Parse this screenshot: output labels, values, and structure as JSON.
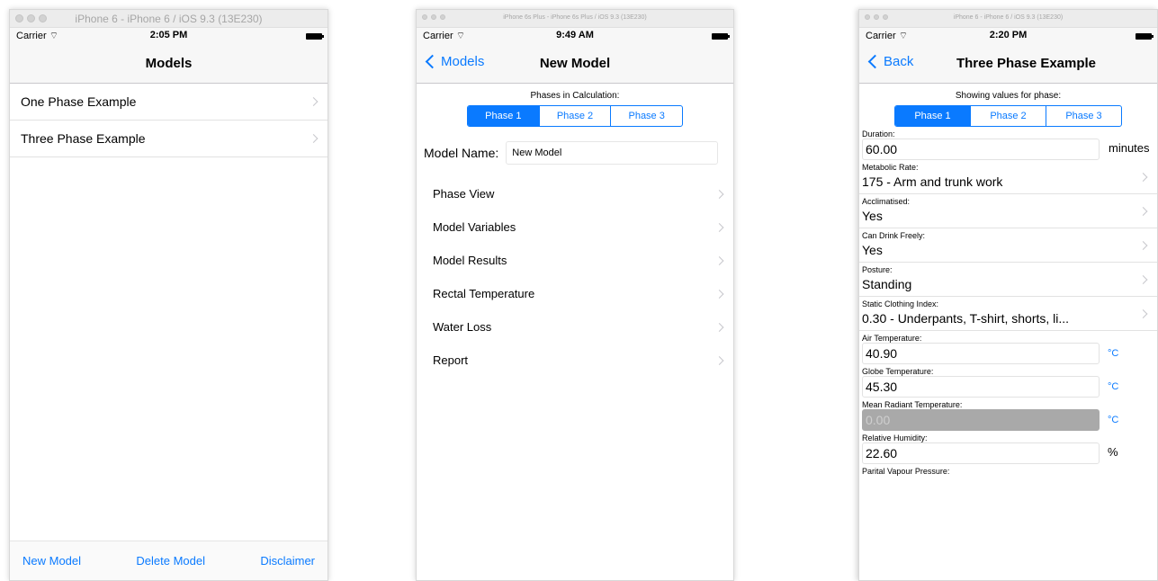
{
  "screen1": {
    "window_title": "iPhone 6 - iPhone 6 / iOS 9.3 (13E230)",
    "carrier": "Carrier",
    "time": "2:05 PM",
    "nav_title": "Models",
    "rows": [
      {
        "label": "One Phase Example"
      },
      {
        "label": "Three Phase Example"
      }
    ],
    "toolbar": {
      "new_model": "New Model",
      "delete_model": "Delete Model",
      "disclaimer": "Disclaimer"
    }
  },
  "screen2": {
    "window_title": "iPhone 6s Plus - iPhone 6s Plus / iOS 9.3 (13E230)",
    "carrier": "Carrier",
    "time": "9:49 AM",
    "back_label": "Models",
    "nav_title": "New Model",
    "phases_caption": "Phases in Calculation:",
    "segments": [
      "Phase 1",
      "Phase 2",
      "Phase 3"
    ],
    "model_name_label": "Model Name:",
    "model_name_value": "New Model",
    "menu": [
      {
        "label": "Phase View"
      },
      {
        "label": "Model Variables"
      },
      {
        "label": "Model Results"
      },
      {
        "label": "Rectal Temperature"
      },
      {
        "label": "Water Loss"
      },
      {
        "label": "Report"
      }
    ]
  },
  "screen3": {
    "window_title": "iPhone 6 - iPhone 6 / iOS 9.3 (13E230)",
    "carrier": "Carrier",
    "time": "2:20 PM",
    "back_label": "Back",
    "nav_title": "Three Phase Example",
    "phase_caption": "Showing values for phase:",
    "segments": [
      "Phase 1",
      "Phase 2",
      "Phase 3"
    ],
    "fields": {
      "duration": {
        "label": "Duration:",
        "value": "60.00",
        "unit": "minutes"
      },
      "metabolic_rate": {
        "label": "Metabolic Rate:",
        "value": "175 - Arm and trunk work"
      },
      "acclimatised": {
        "label": "Acclimatised:",
        "value": "Yes"
      },
      "can_drink": {
        "label": "Can Drink Freely:",
        "value": "Yes"
      },
      "posture": {
        "label": "Posture:",
        "value": "Standing"
      },
      "clothing": {
        "label": "Static Clothing Index:",
        "value": "0.30 - Underpants, T-shirt, shorts, li..."
      },
      "air_temp": {
        "label": "Air Temperature:",
        "value": "40.90",
        "unit": "°C"
      },
      "globe_temp": {
        "label": "Globe Temperature:",
        "value": "45.30",
        "unit": "°C"
      },
      "mean_radiant": {
        "label": "Mean Radiant Temperature:",
        "value": "0.00",
        "unit": "°C"
      },
      "humidity": {
        "label": "Relative Humidity:",
        "value": "22.60",
        "unit": "%"
      },
      "vapour": {
        "label": "Parital Vapour Pressure:"
      }
    }
  }
}
